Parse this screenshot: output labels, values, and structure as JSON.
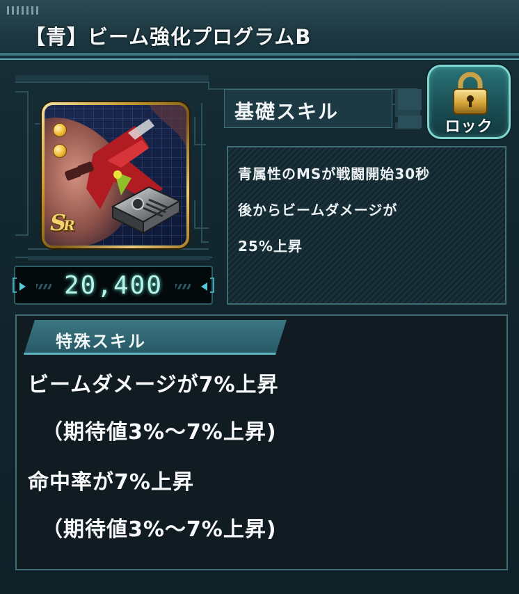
{
  "header": {
    "title": "【青】ビーム強化プログラムB"
  },
  "item": {
    "rarity_main": "S",
    "rarity_sub": "R",
    "score": "20,400",
    "icon": "beam-program-chip-icon"
  },
  "basic_skill": {
    "label": "基礎スキル",
    "lines": [
      "青属性のMSが戦闘開始30秒",
      "後からビームダメージが",
      "25%上昇"
    ]
  },
  "lock_button": {
    "label": "ロック",
    "icon": "padlock-icon"
  },
  "special_skill": {
    "label": "特殊スキル",
    "lines": [
      "ビームダメージが7%上昇",
      "（期待値3%～7%上昇)",
      "命中率が7%上昇",
      "（期待値3%～7%上昇)"
    ]
  },
  "colors": {
    "accent": "#5fa6b2",
    "score_glow": "#b9f2e8",
    "lock_teal": "#2a7478",
    "card_gold": "#c79a35"
  }
}
